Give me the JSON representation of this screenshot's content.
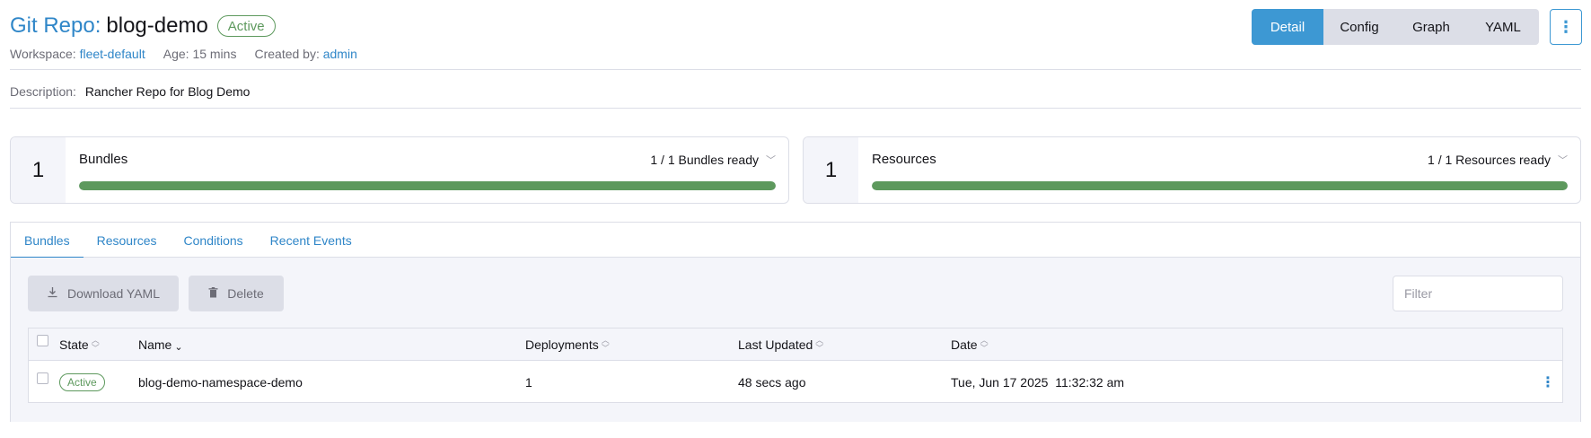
{
  "header": {
    "title_prefix": "Git Repo:",
    "title_name": "blog-demo",
    "status": "Active",
    "workspace_label": "Workspace:",
    "workspace_value": "fleet-default",
    "age_label": "Age:",
    "age_value": "15 mins",
    "created_label": "Created by:",
    "created_value": "admin",
    "description_label": "Description:",
    "description_value": "Rancher Repo for Blog Demo"
  },
  "view_switch": {
    "items": [
      "Detail",
      "Config",
      "Graph",
      "YAML"
    ],
    "active": "Detail",
    "more_icon": "kebab-vertical-icon"
  },
  "summary": {
    "bundles": {
      "count": "1",
      "label": "Bundles",
      "ready_text": "1 / 1 Bundles ready",
      "progress": 1.0
    },
    "resources": {
      "count": "1",
      "label": "Resources",
      "ready_text": "1 / 1 Resources ready",
      "progress": 1.0
    }
  },
  "tabs": {
    "items": [
      "Bundles",
      "Resources",
      "Conditions",
      "Recent Events"
    ],
    "active": "Bundles"
  },
  "toolbar": {
    "download_label": "Download YAML",
    "delete_label": "Delete",
    "filter_placeholder": "Filter"
  },
  "table": {
    "columns": [
      "State",
      "Name",
      "Deployments",
      "Last Updated",
      "Date"
    ],
    "sorted_column": "Name",
    "rows": [
      {
        "state": "Active",
        "name": "blog-demo-namespace-demo",
        "deployments": "1",
        "last_updated": "48 secs ago",
        "date": "Tue, Jun 17 2025  11:32:32 am"
      }
    ]
  },
  "colors": {
    "link": "#2f86c8",
    "primary": "#3d98d3",
    "success": "#5d995d",
    "border": "#dcdee7",
    "muted_bg": "#f4f5fa"
  }
}
